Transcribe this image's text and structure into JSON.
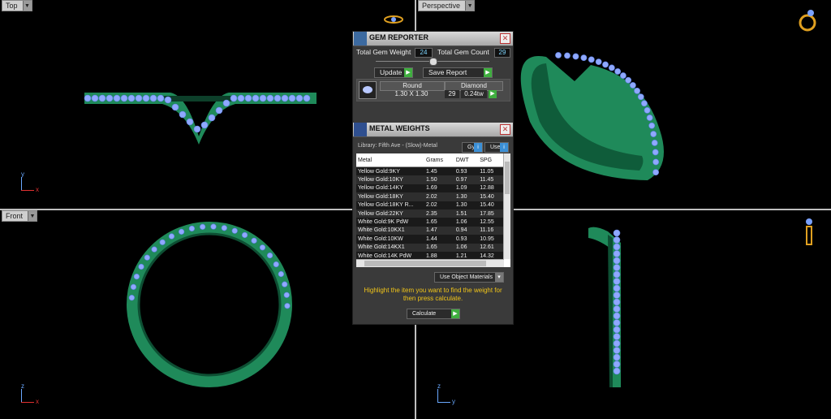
{
  "viewports": {
    "top": {
      "label": "Top",
      "axis_v": "y",
      "axis_h": "x"
    },
    "perspective": {
      "label": "Perspective"
    },
    "front": {
      "label": "Front",
      "axis_v": "z",
      "axis_h": "x"
    },
    "right": {
      "axis_v": "z",
      "axis_h": "y"
    }
  },
  "gem_reporter": {
    "title": "GEM REPORTER",
    "total_gem_weight_label": "Total Gem Weight",
    "total_gem_weight_value": "24",
    "total_gem_count_label": "Total Gem Count",
    "total_gem_count_value": "29",
    "update_label": "Update",
    "save_report_label": "Save Report",
    "gem": {
      "shape": "Round",
      "size": "1.30 X 1.30",
      "type": "Diamond",
      "count": "29",
      "weight": "0.24tw"
    }
  },
  "metal_weights": {
    "title": "METAL WEIGHTS",
    "library": "Library: Fifth Ave - (Slow)-Metal",
    "btn_gravity": "Gy",
    "btn_user": "User",
    "columns": [
      "Metal",
      "Grams",
      "DWT",
      "SPG"
    ],
    "rows": [
      [
        "Yellow Gold:9KY",
        "1.45",
        "0.93",
        "11.05"
      ],
      [
        "Yellow Gold:10KY",
        "1.50",
        "0.97",
        "11.45"
      ],
      [
        "Yellow Gold:14KY",
        "1.69",
        "1.09",
        "12.88"
      ],
      [
        "Yellow Gold:18KY",
        "2.02",
        "1.30",
        "15.40"
      ],
      [
        "Yellow Gold:18KY R...",
        "2.02",
        "1.30",
        "15.40"
      ],
      [
        "Yellow Gold:22KY",
        "2.35",
        "1.51",
        "17.85"
      ],
      [
        "White Gold:9K PdW",
        "1.65",
        "1.06",
        "12.55"
      ],
      [
        "White Gold:10KX1",
        "1.47",
        "0.94",
        "11.16"
      ],
      [
        "White Gold:10KW",
        "1.44",
        "0.93",
        "10.95"
      ],
      [
        "White Gold:14KX1",
        "1.65",
        "1.06",
        "12.61"
      ],
      [
        "White Gold:14K PdW",
        "1.88",
        "1.21",
        "14.32"
      ]
    ],
    "use_object_materials": "Use Object Materials",
    "hint": "Highlight the item you want to find the weight for then press calculate.",
    "calculate_label": "Calculate"
  },
  "colors": {
    "metal": "#1f8a5a",
    "gem": "#8fa8ff",
    "panel": "#3a3a3a",
    "accent_green": "#3fae3f"
  }
}
